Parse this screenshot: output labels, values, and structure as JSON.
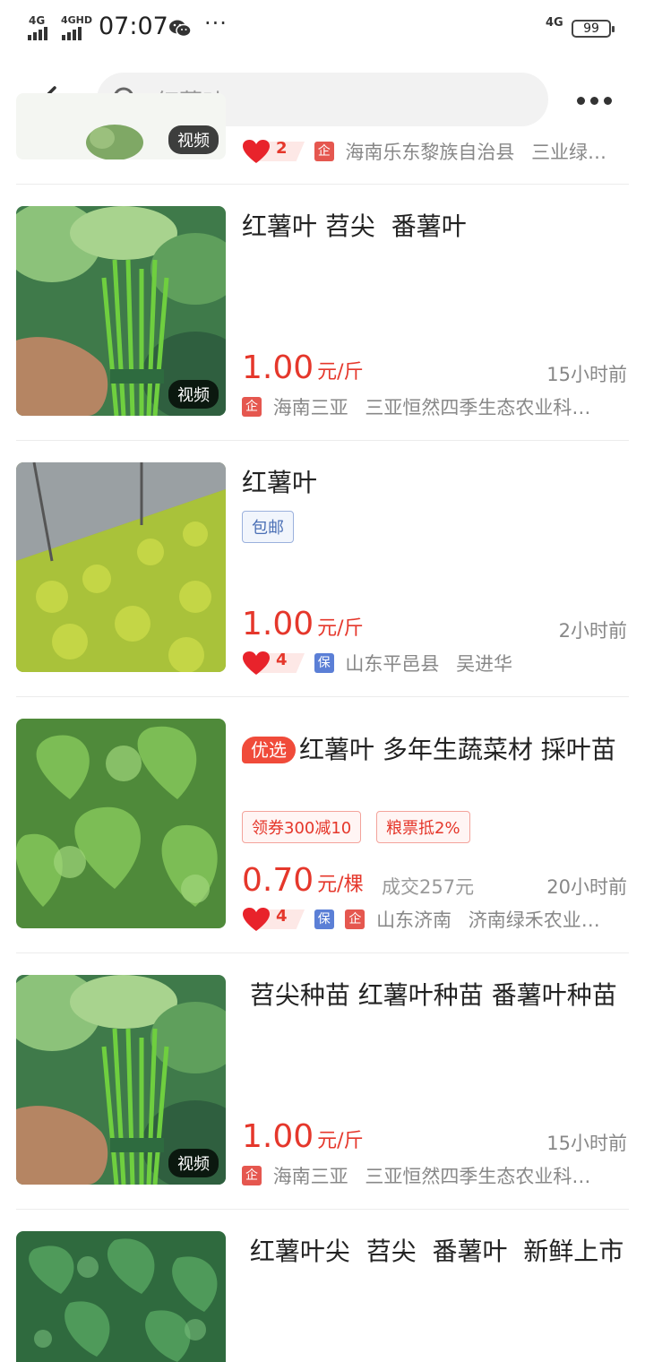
{
  "status_bar": {
    "signal1": "4G",
    "signal2": "4GHD",
    "time": "07:07",
    "more": "···",
    "network_right": "4G",
    "battery": "99"
  },
  "top_bar": {
    "search_query": "红薯叶"
  },
  "colors": {
    "price": "#e5372b",
    "accent": "#f04b3a"
  },
  "items": [
    {
      "video_label": "视频",
      "likes": "2",
      "location": "海南乐东黎族自治县",
      "shop": "三业绿…",
      "image": "sweet-potato-seedlings"
    },
    {
      "title": "红薯叶 苕尖  番薯叶",
      "price": "1.00",
      "unit": "元/斤",
      "time": "15小时前",
      "location": "海南三亚",
      "shop": "三亚恒然四季生态农业科…",
      "video_label": "视频",
      "image": "hand-holding-bundle"
    },
    {
      "title": "红薯叶",
      "chip": "包邮",
      "price": "1.00",
      "unit": "元/斤",
      "time": "2小时前",
      "likes": "4",
      "location": "山东平邑县",
      "shop": "吴进华",
      "image": "greenhouse-field"
    },
    {
      "badge": "优选",
      "title": "红薯叶 多年生蔬菜材 採叶苗",
      "coupons": [
        "领券300减10",
        "粮票抵2%"
      ],
      "price": "0.70",
      "unit": "元/棵",
      "deal": "成交257元",
      "time": "20小时前",
      "likes": "4",
      "location": "山东济南",
      "shop": "济南绿禾农业…",
      "image": "leaves-closeup"
    },
    {
      "title": " 苕尖种苗 红薯叶种苗 番薯叶种苗",
      "price": "1.00",
      "unit": "元/斤",
      "time": "15小时前",
      "location": "海南三亚",
      "shop": "三亚恒然四季生态农业科…",
      "video_label": "视频",
      "image": "hand-holding-bundle"
    },
    {
      "title": " 红薯叶尖  苕尖  番薯叶  新鲜上市",
      "image": "leaves-in-crate"
    }
  ]
}
